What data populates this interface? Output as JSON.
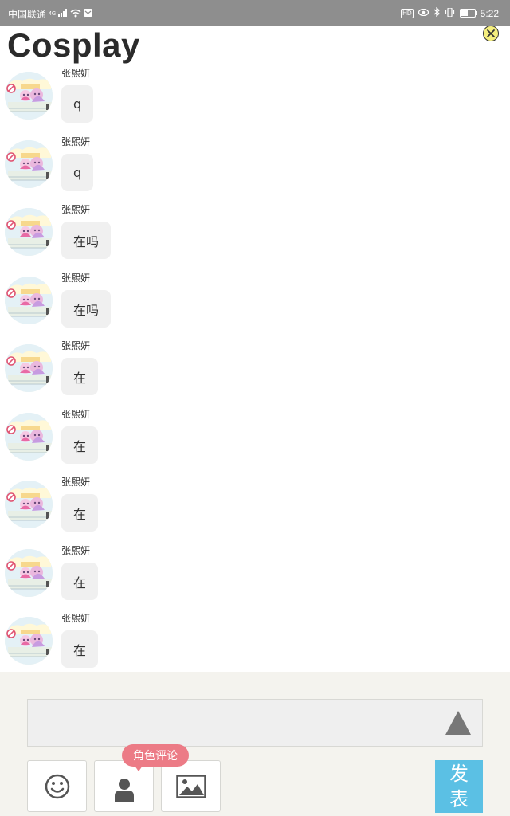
{
  "status_bar": {
    "carrier": "中国联通",
    "signal_label": "4G",
    "hd_label": "HD",
    "time": "5:22",
    "battery_level": 0.55,
    "icons": [
      "signal-icon",
      "wifi-icon",
      "message-icon",
      "hd-icon",
      "eye-icon",
      "bluetooth-icon",
      "vibrate-icon",
      "battery-icon"
    ]
  },
  "header": {
    "title": "Cosplay",
    "close_icon": "close-icon",
    "close_color": "#f4ee7e"
  },
  "messages": [
    {
      "user": "张熙妍",
      "text": "q"
    },
    {
      "user": "张熙妍",
      "text": "q"
    },
    {
      "user": "张熙妍",
      "text": "在吗"
    },
    {
      "user": "张熙妍",
      "text": "在吗"
    },
    {
      "user": "张熙妍",
      "text": "在"
    },
    {
      "user": "张熙妍",
      "text": "在"
    },
    {
      "user": "张熙妍",
      "text": "在"
    },
    {
      "user": "张熙妍",
      "text": "在"
    },
    {
      "user": "张熙妍",
      "text": "在"
    }
  ],
  "composer": {
    "input_value": "",
    "send_icon": "triangle-up-icon",
    "tools": [
      "emoji-icon",
      "person-icon",
      "image-icon"
    ],
    "tooltip": "角色评论",
    "tooltip_color": "#ec7b86",
    "post_label_line1": "发",
    "post_label_line2": "表",
    "post_color": "#5bc0e4"
  }
}
